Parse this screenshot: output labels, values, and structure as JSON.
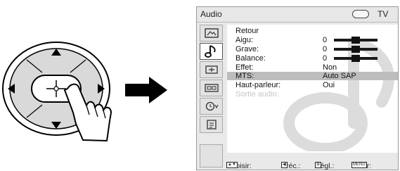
{
  "window": {
    "title": "Audio",
    "input_label": "TV"
  },
  "sidebar": {
    "icons": [
      "picture-icon",
      "music-note-icon",
      "channel-icon",
      "function-icon",
      "timer-icon",
      "setup-icon"
    ],
    "active_index": 1
  },
  "menu": {
    "rows": [
      {
        "label": "Retour",
        "value": ""
      },
      {
        "label": "Aigu:",
        "value": "0",
        "slider": 0.5
      },
      {
        "label": "Grave:",
        "value": "0",
        "slider": 0.5
      },
      {
        "label": "Balance:",
        "value": "0",
        "slider": 0.5
      },
      {
        "label": "Effet:",
        "value": "Non"
      },
      {
        "label": "MTS:",
        "value": "Auto SAP",
        "selected": true
      },
      {
        "label": "Haut-parleur:",
        "value": "Oui"
      },
      {
        "label": "Sortie audio:",
        "value": "",
        "disabled": true
      }
    ]
  },
  "footer": {
    "choose": "Choisir:",
    "previous": "Préc.:",
    "adjust": "Régl.:",
    "exit": "Sortir:",
    "menu_key": "MENU"
  }
}
